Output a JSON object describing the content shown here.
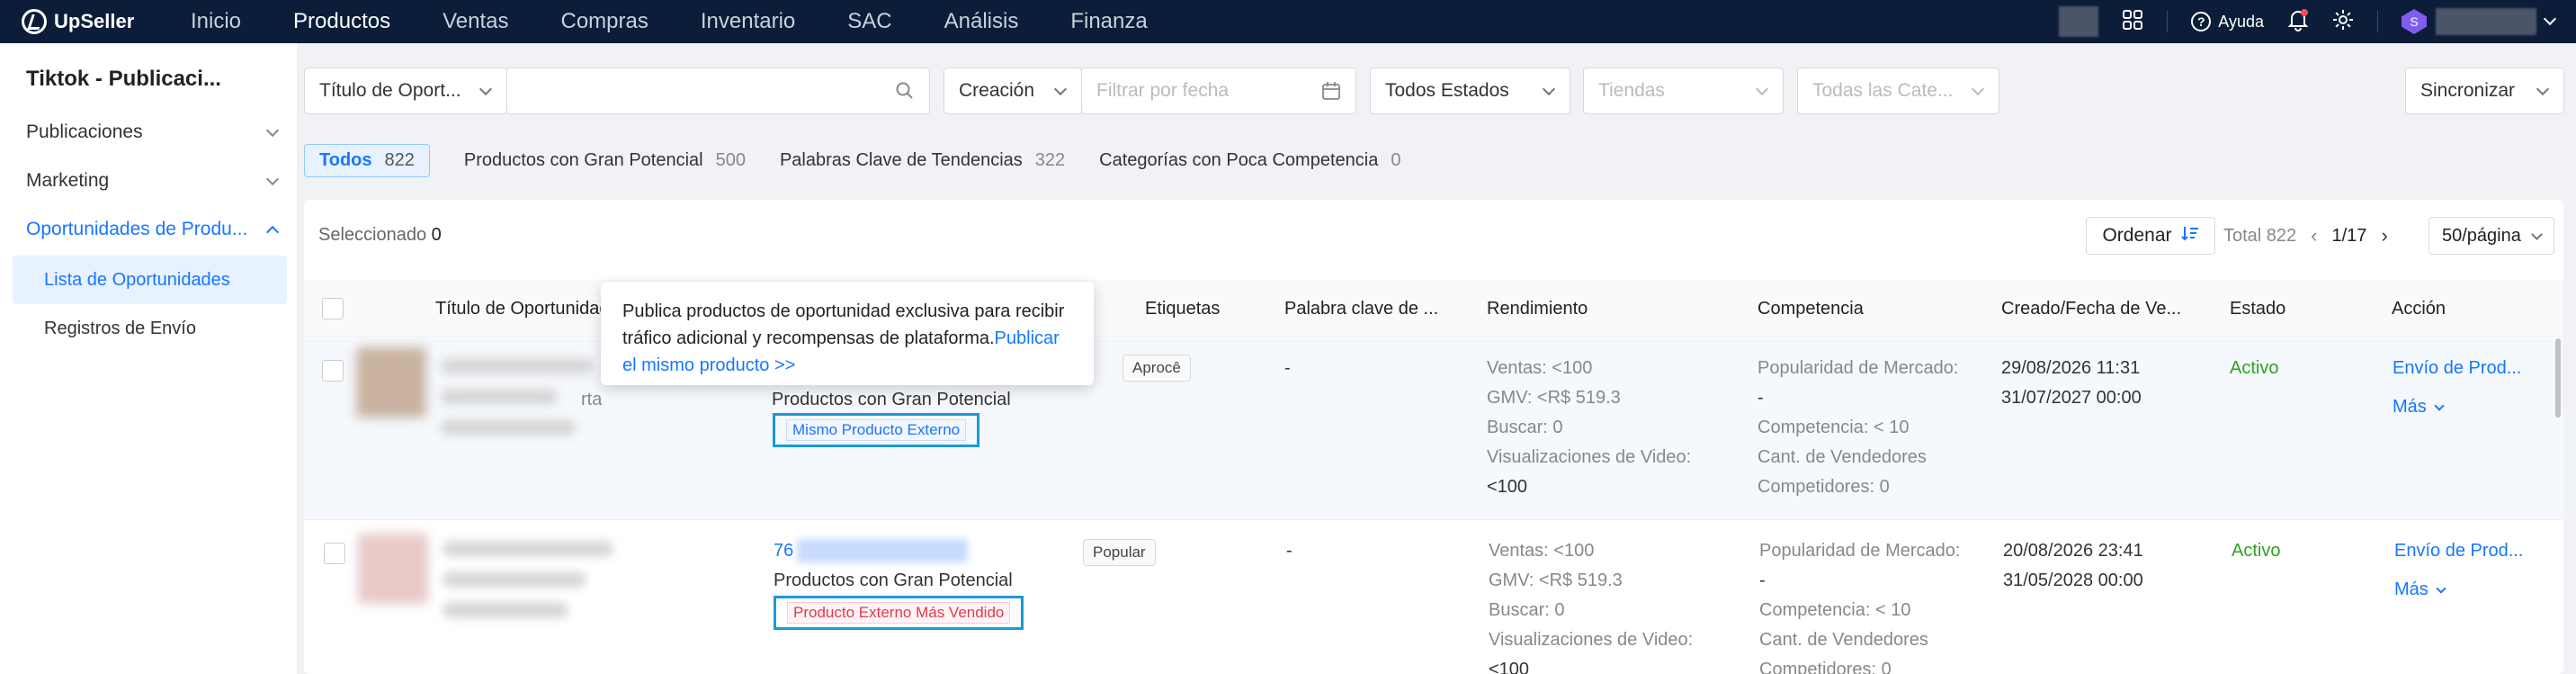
{
  "nav": {
    "brand": "UpSeller",
    "menu": [
      "Inicio",
      "Productos",
      "Ventas",
      "Compras",
      "Inventario",
      "SAC",
      "Análisis",
      "Finanza"
    ],
    "active_menu": "Productos",
    "help": "Ayuda",
    "avatar_letter": "S"
  },
  "sidebar": {
    "title": "Tiktok - Publicaci...",
    "groups": [
      {
        "label": "Publicaciones"
      },
      {
        "label": "Marketing"
      },
      {
        "label": "Oportunidades de Produ..."
      }
    ],
    "subitems": [
      {
        "label": "Lista de Oportunidades",
        "active": true
      },
      {
        "label": "Registros de Envío",
        "active": false
      }
    ]
  },
  "filters": {
    "search_type": "Título de Oport...",
    "date_type": "Creación",
    "date_placeholder": "Filtrar por fecha",
    "status": "Todos Estados",
    "stores_placeholder": "Tiendas",
    "categories_placeholder": "Todas las Cate...",
    "sync_label": "Sincronizar"
  },
  "tabs": [
    {
      "label": "Todos",
      "count": "822"
    },
    {
      "label": "Productos con Gran Potencial",
      "count": "500"
    },
    {
      "label": "Palabras Clave de Tendencias",
      "count": "322"
    },
    {
      "label": "Categorías con Poca Competencia",
      "count": "0"
    }
  ],
  "toolbar": {
    "selected_label": "Seleccionado",
    "selected_count": "0",
    "order_label": "Ordenar",
    "total": "Total 822",
    "page": "1/17",
    "per_page": "50/página"
  },
  "columns": [
    "Título de Oportunidad",
    "Etiquetas",
    "Palabra clave de ...",
    "Rendimiento",
    "Competencia",
    "Creado/Fecha de Ve...",
    "Estado",
    "Acción"
  ],
  "rows": [
    {
      "title_partial": "rta",
      "id_partial": "",
      "tag_line": "Productos con Gran Potencial",
      "badge": "Mismo Producto Externo",
      "pill": "Aprocê",
      "keyword": "-",
      "perf": [
        "Ventas: <100",
        "GMV: <R$ 519.3",
        "Buscar: 0",
        "Visualizaciones de Video:",
        "<100"
      ],
      "comp": [
        "Popularidad de Mercado:",
        "-",
        "Competencia: < 10",
        "Cant. de Vendedores",
        "Competidores: 0"
      ],
      "created": "29/08/2026 11:31",
      "expires": "31/07/2027 00:00",
      "status": "Activo",
      "action": "Envío de Prod...",
      "more": "Más"
    },
    {
      "title_partial": "",
      "id_partial": "76",
      "tag_line": "Productos con Gran Potencial",
      "badge": "Producto Externo Más Vendido",
      "pill": "Popular",
      "keyword": "-",
      "perf": [
        "Ventas: <100",
        "GMV: <R$ 519.3",
        "Buscar: 0",
        "Visualizaciones de Video:",
        "<100"
      ],
      "comp": [
        "Popularidad de Mercado:",
        "-",
        "Competencia: < 10",
        "Cant. de Vendedores",
        "Competidores: 0"
      ],
      "created": "20/08/2026 23:41",
      "expires": "31/05/2028 00:00",
      "status": "Activo",
      "action": "Envío de Prod...",
      "more": "Más"
    }
  ],
  "tooltip": {
    "text": "Publica productos de oportunidad exclusiva para recibir tráfico adicional y recompensas de plataforma.",
    "link": "Publicar el mismo producto >>"
  }
}
